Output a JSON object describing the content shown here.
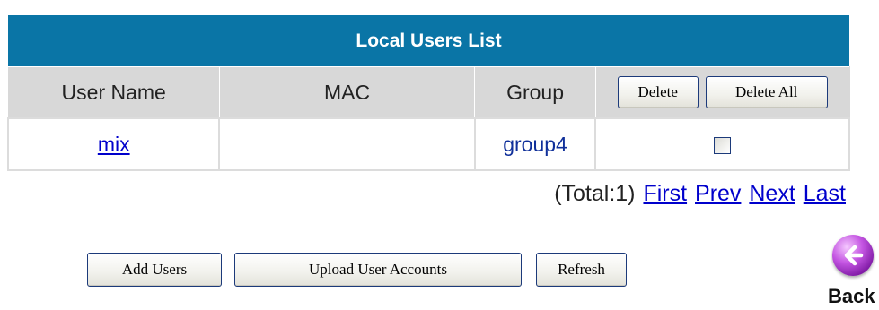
{
  "table": {
    "title": "Local Users List",
    "headers": {
      "user_name": "User Name",
      "mac": "MAC",
      "group": "Group"
    },
    "delete_label": "Delete",
    "delete_all_label": "Delete All",
    "rows": [
      {
        "user_name": "mix",
        "mac": "",
        "group": "group4",
        "checked": false
      }
    ]
  },
  "pager": {
    "total": "(Total:1)",
    "first": "First",
    "prev": "Prev",
    "next": "Next",
    "last": "Last"
  },
  "actions": {
    "add_users": "Add Users",
    "upload_accounts": "Upload User Accounts",
    "refresh": "Refresh"
  },
  "back": {
    "label": "Back",
    "icon": "back-arrow-icon"
  },
  "colors": {
    "title_bar": "#0a75a6",
    "header_bg": "#d8d8d8",
    "link": "#0000cc"
  }
}
